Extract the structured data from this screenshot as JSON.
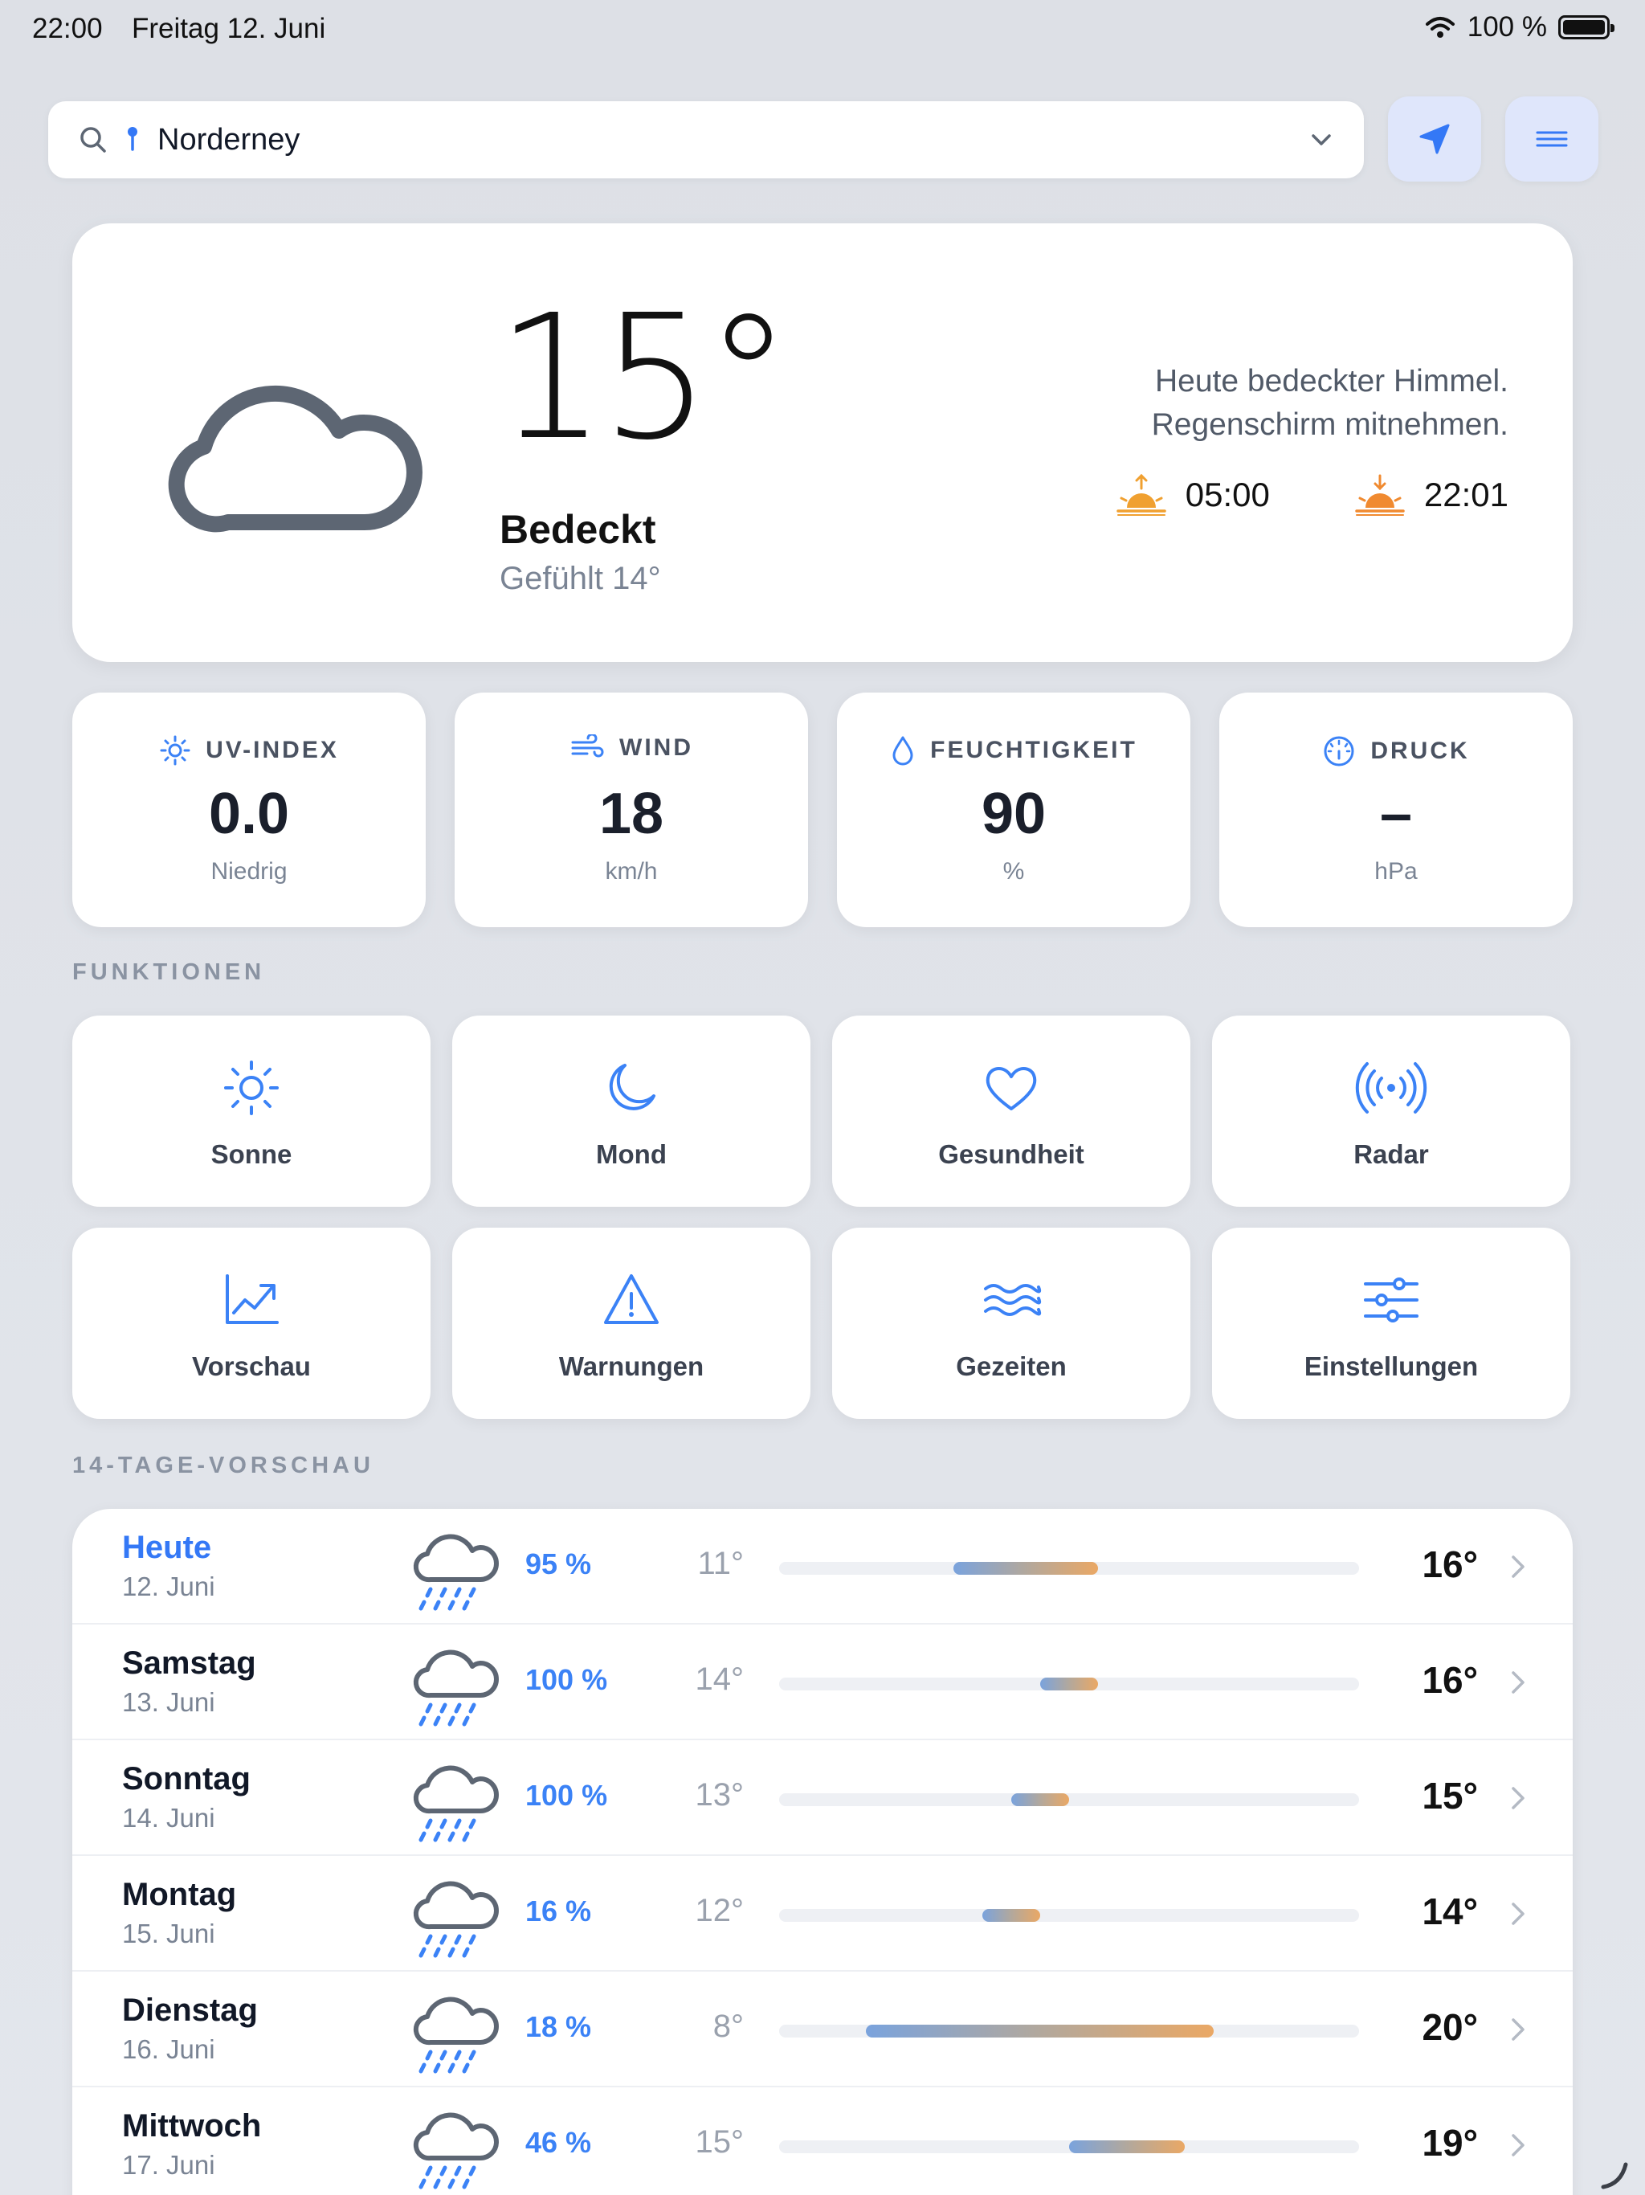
{
  "status_bar": {
    "time": "22:00",
    "date": "Freitag 12. Juni",
    "battery": "100 %"
  },
  "search": {
    "location": "Norderney"
  },
  "current": {
    "temperature": "15°",
    "condition": "Bedeckt",
    "feels_like": "Gefühlt 14°",
    "description_line1": "Heute bedeckter Himmel.",
    "description_line2": "Regenschirm mitnehmen.",
    "sunrise": "05:00",
    "sunset": "22:01"
  },
  "metrics": [
    {
      "label": "UV-INDEX",
      "value": "0.0",
      "unit": "Niedrig",
      "icon": "sun-icon"
    },
    {
      "label": "WIND",
      "value": "18",
      "unit": "km/h",
      "icon": "wind-icon"
    },
    {
      "label": "FEUCHTIGKEIT",
      "value": "90",
      "unit": "%",
      "icon": "droplet-icon"
    },
    {
      "label": "DRUCK",
      "value": "–",
      "unit": "hPa",
      "icon": "gauge-icon"
    }
  ],
  "sections": {
    "functions": "FUNKTIONEN",
    "forecast": "14-TAGE-VORSCHAU"
  },
  "functions": [
    {
      "label": "Sonne",
      "icon": "sun-icon"
    },
    {
      "label": "Mond",
      "icon": "moon-icon"
    },
    {
      "label": "Gesundheit",
      "icon": "heart-icon"
    },
    {
      "label": "Radar",
      "icon": "radar-icon"
    },
    {
      "label": "Vorschau",
      "icon": "chart-trend-icon"
    },
    {
      "label": "Warnungen",
      "icon": "warning-icon"
    },
    {
      "label": "Gezeiten",
      "icon": "waves-icon"
    },
    {
      "label": "Einstellungen",
      "icon": "sliders-icon"
    }
  ],
  "forecast": [
    {
      "day": "Heute",
      "date": "12. Juni",
      "precip": "95 %",
      "low": "11°",
      "high": "16°",
      "low_val": 11,
      "high_val": 16,
      "today": true
    },
    {
      "day": "Samstag",
      "date": "13. Juni",
      "precip": "100 %",
      "low": "14°",
      "high": "16°",
      "low_val": 14,
      "high_val": 16,
      "today": false
    },
    {
      "day": "Sonntag",
      "date": "14. Juni",
      "precip": "100 %",
      "low": "13°",
      "high": "15°",
      "low_val": 13,
      "high_val": 15,
      "today": false
    },
    {
      "day": "Montag",
      "date": "15. Juni",
      "precip": "16 %",
      "low": "12°",
      "high": "14°",
      "low_val": 12,
      "high_val": 14,
      "today": false
    },
    {
      "day": "Dienstag",
      "date": "16. Juni",
      "precip": "18 %",
      "low": "8°",
      "high": "20°",
      "low_val": 8,
      "high_val": 20,
      "today": false
    },
    {
      "day": "Mittwoch",
      "date": "17. Juni",
      "precip": "46 %",
      "low": "15°",
      "high": "19°",
      "low_val": 15,
      "high_val": 19,
      "today": false
    }
  ],
  "colors": {
    "accent": "#3478f6",
    "icon_blue": "#3b82f6",
    "sun_orange": "#f0a030",
    "cloud_gray": "#5d6673"
  }
}
